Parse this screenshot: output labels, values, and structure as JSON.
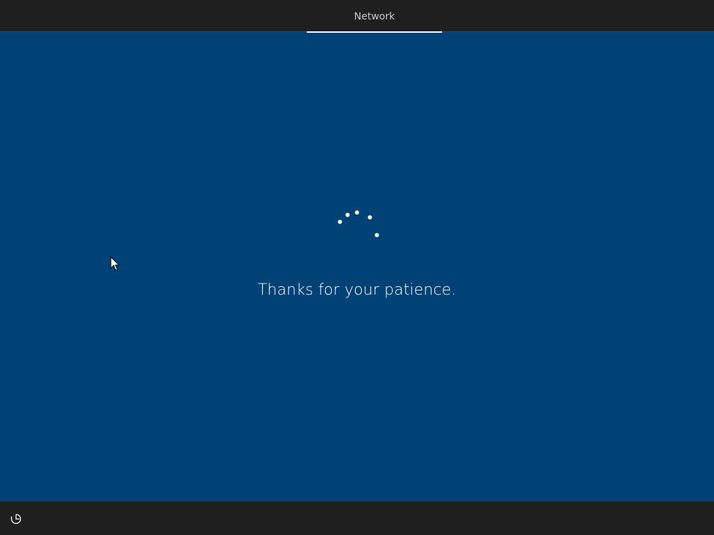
{
  "header": {
    "steps": [
      {
        "label": "Network",
        "active": true
      }
    ]
  },
  "status": {
    "message": "Thanks for your patience.",
    "spinner_icon": "loading-dots-spinner"
  },
  "footer": {
    "ease_of_access_icon": "ease-of-access-icon"
  },
  "colors": {
    "background": "#004275",
    "bars": "#1f1f1f",
    "text": "#ffffff",
    "tab_text": "#c8c8c8"
  }
}
